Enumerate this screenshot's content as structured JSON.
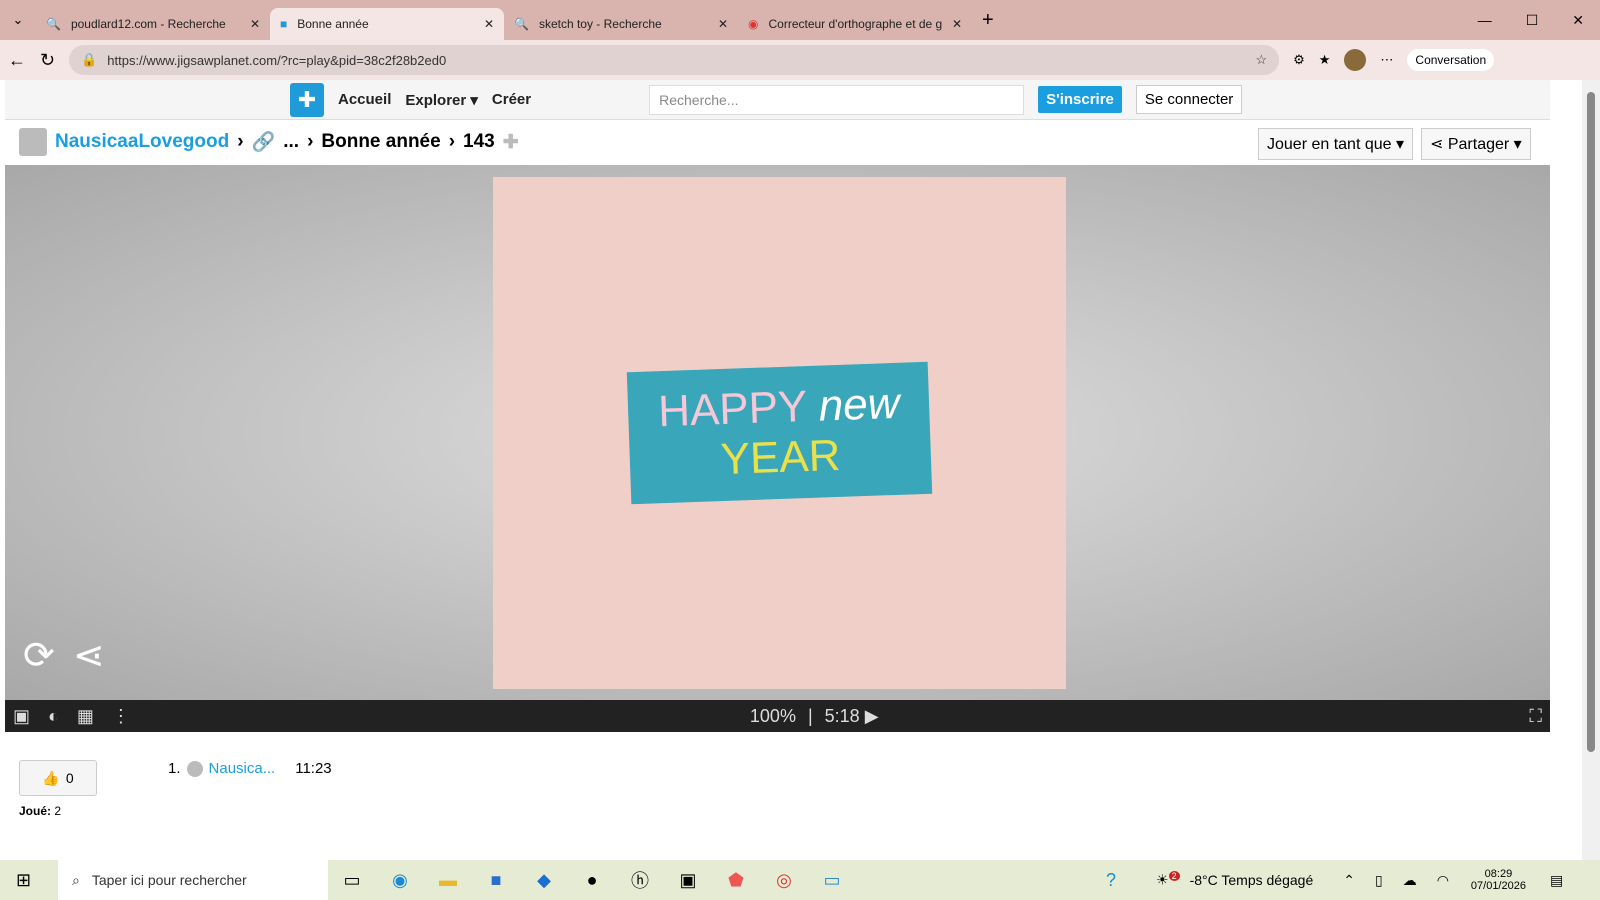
{
  "tabs": [
    {
      "label": "poudlard12.com - Recherche"
    },
    {
      "label": "Bonne année"
    },
    {
      "label": "sketch toy - Recherche"
    },
    {
      "label": "Correcteur d'orthographe et de gr"
    }
  ],
  "url": "https://www.jigsawplanet.com/?rc=play&pid=38c2f28b2ed0",
  "copilot": "Conversation",
  "nav": {
    "home": "Accueil",
    "explore": "Explorer",
    "create": "Créer",
    "search_placeholder": "Recherche...",
    "signup": "S'inscrire",
    "login": "Se connecter"
  },
  "breadcrumb": {
    "user": "NausicaaLovegood",
    "ellipsis": "...",
    "title": "Bonne année",
    "pieces": "143"
  },
  "play_as": "Jouer en tant que",
  "share": "Partager",
  "puzzle": {
    "happy": "HAPPY",
    "new": "new",
    "year": "YEAR"
  },
  "controls": {
    "zoom": "100%",
    "time": "5:18"
  },
  "likes": "0",
  "played_label": "Joué:",
  "played": "2",
  "leader": [
    {
      "rank": "1.",
      "name": "Nausica...",
      "time": "11:23"
    }
  ],
  "taskbar": {
    "search": "Taper ici pour rechercher",
    "weather": "-8°C  Temps dégagé",
    "badge": "2",
    "time": "08:29",
    "date": "07/01/2026"
  }
}
